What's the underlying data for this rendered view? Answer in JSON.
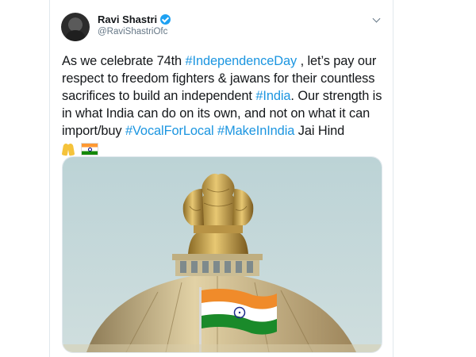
{
  "user": {
    "display_name": "Ravi Shastri",
    "handle": "@RaviShastriOfc",
    "verified": true
  },
  "tweet": {
    "segments": [
      {
        "text": "As we celebrate 74th ",
        "type": "text"
      },
      {
        "text": "#IndependenceDay",
        "type": "hashtag"
      },
      {
        "text": " , let’s pay our respect to freedom fighters & jawans for their countless sacrifices to build an independent ",
        "type": "text"
      },
      {
        "text": "#India",
        "type": "hashtag"
      },
      {
        "text": ". Our strength is in what India can do on its own, and not on what it can import/buy ",
        "type": "text"
      },
      {
        "text": "#VocalForLocal",
        "type": "hashtag"
      },
      {
        "text": " ",
        "type": "text"
      },
      {
        "text": "#MakeInIndia",
        "type": "hashtag"
      },
      {
        "text": " Jai Hind",
        "type": "text"
      }
    ],
    "emojis": [
      "folded-hands-icon",
      "india-flag-icon"
    ]
  },
  "colors": {
    "hashtag": "#1b95e0",
    "verified": "#1da1f2",
    "secondary_text": "#657786"
  }
}
